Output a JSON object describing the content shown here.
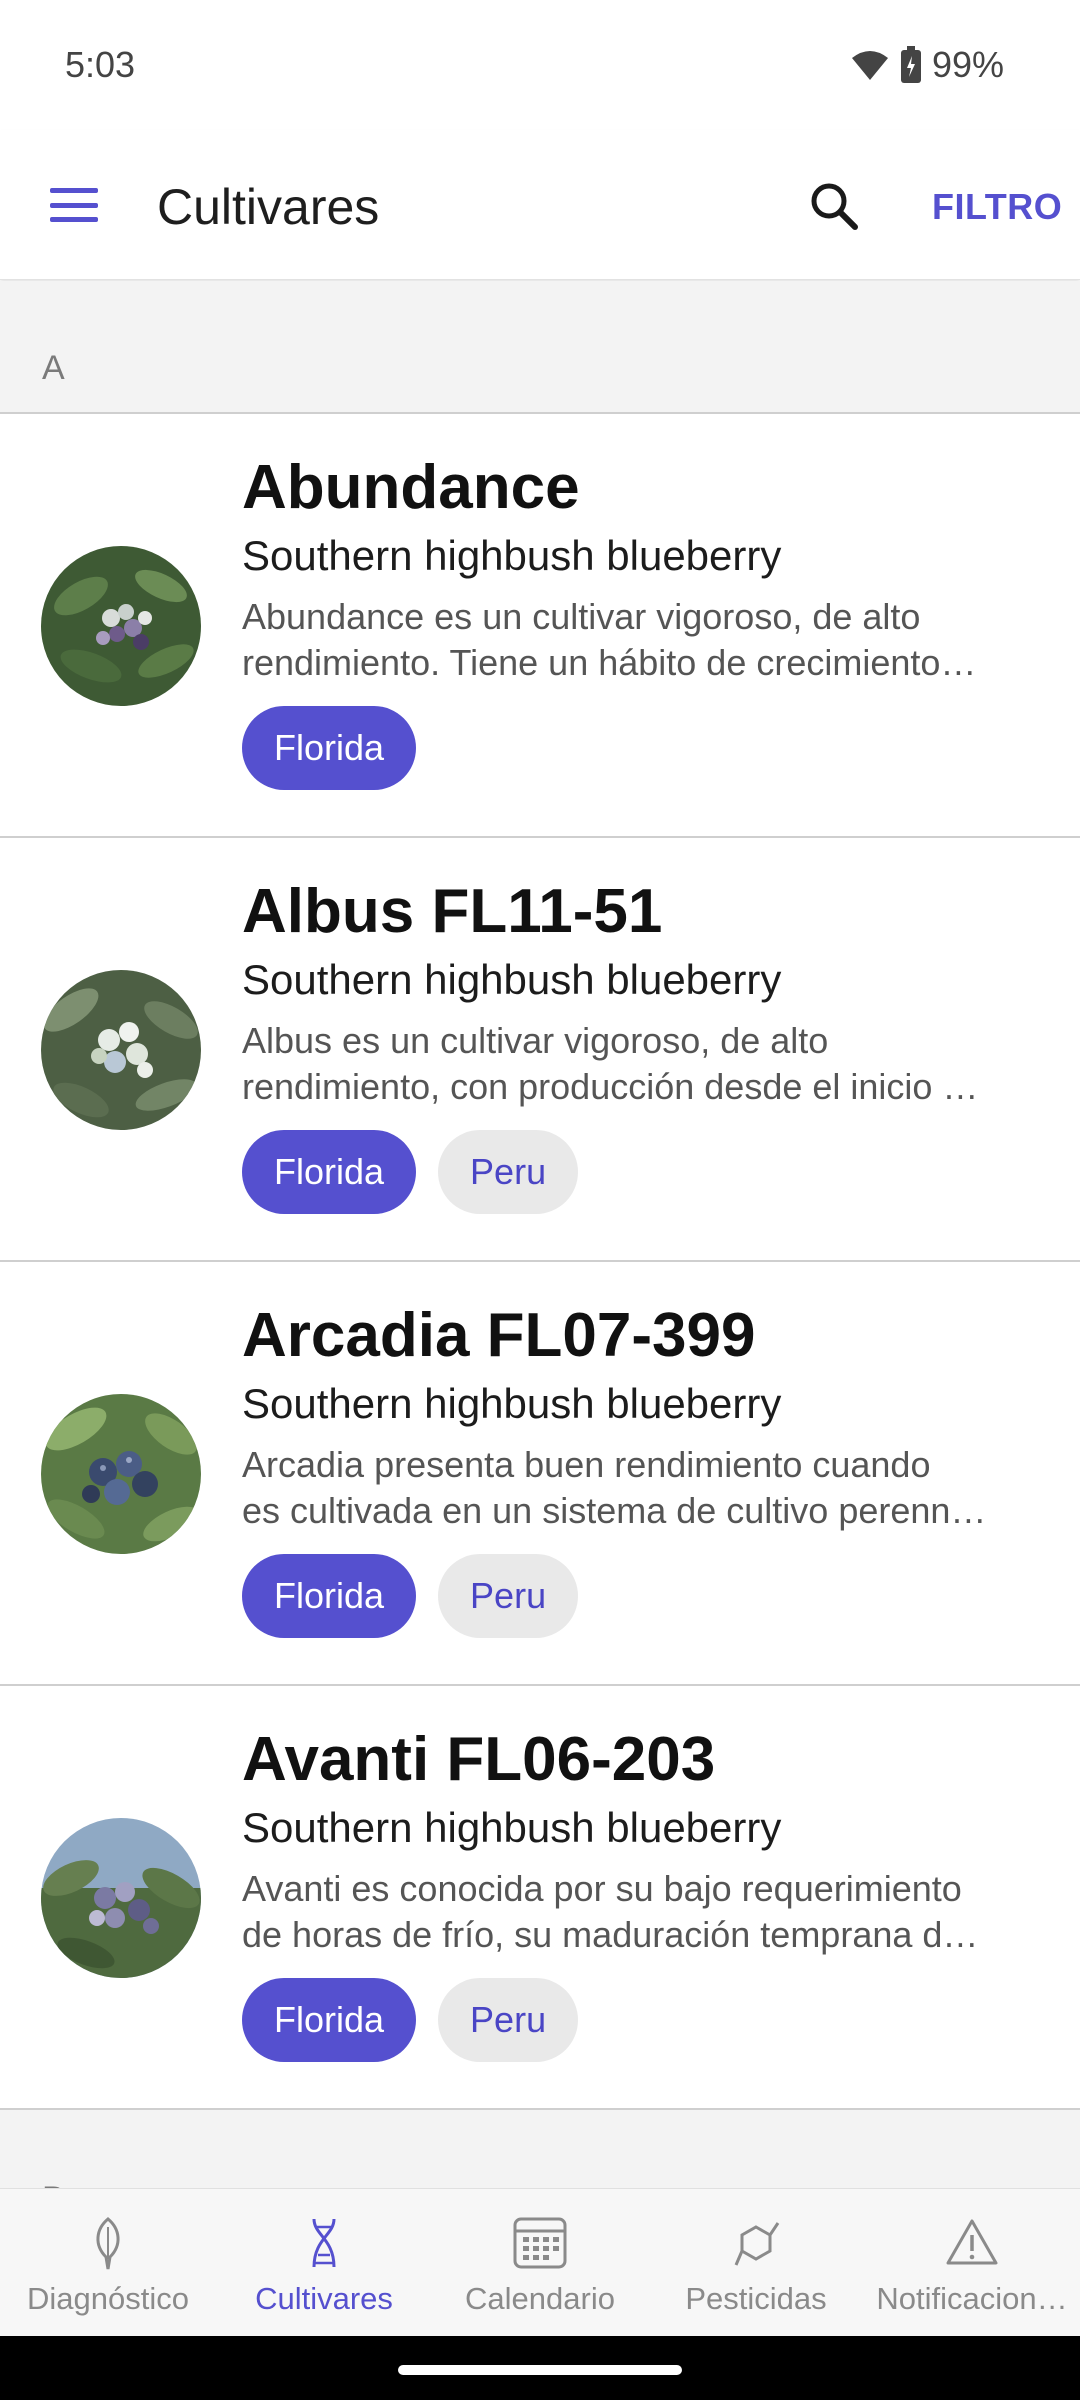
{
  "status_bar": {
    "time": "5:03",
    "battery": "99%"
  },
  "app_bar": {
    "title": "Cultivares",
    "filter_label": "FILTRO"
  },
  "sections": [
    {
      "letter": "A"
    }
  ],
  "items": [
    {
      "name": "Abundance",
      "species": "Southern highbush blueberry",
      "desc_line1": "Abundance es un cultivar vigoroso, de alto",
      "desc_line2": "rendimiento. Tiene un hábito de crecimiento…",
      "tags": [
        "Florida"
      ]
    },
    {
      "name": "Albus FL11-51",
      "species": "Southern highbush blueberry",
      "desc_line1": "Albus es un cultivar vigoroso, de alto",
      "desc_line2": "rendimiento, con producción desde el inicio …",
      "tags": [
        "Florida",
        "Peru"
      ]
    },
    {
      "name": "Arcadia FL07-399",
      "species": "Southern highbush blueberry",
      "desc_line1": "Arcadia presenta buen rendimiento cuando",
      "desc_line2": "es cultivada en un sistema de cultivo perenn…",
      "tags": [
        "Florida",
        "Peru"
      ]
    },
    {
      "name": "Avanti FL06-203",
      "species": "Southern highbush blueberry",
      "desc_line1": "Avanti es conocida por su bajo requerimiento",
      "desc_line2": "de horas de frío, su maduración temprana d…",
      "tags": [
        "Florida",
        "Peru"
      ]
    }
  ],
  "next_section": {
    "letter": "B"
  },
  "bottom_nav": [
    {
      "label": "Diagnóstico",
      "icon": "leaf-icon",
      "active": false
    },
    {
      "label": "Cultivares",
      "icon": "dna-icon",
      "active": true
    },
    {
      "label": "Calendario",
      "icon": "calendar-icon",
      "active": false
    },
    {
      "label": "Pesticidas",
      "icon": "molecule-icon",
      "active": false
    },
    {
      "label": "Notificacion…",
      "icon": "warning-icon",
      "active": false
    }
  ],
  "colors": {
    "accent": "#5550cf",
    "chip_secondary_bg": "#e9e9e9"
  }
}
